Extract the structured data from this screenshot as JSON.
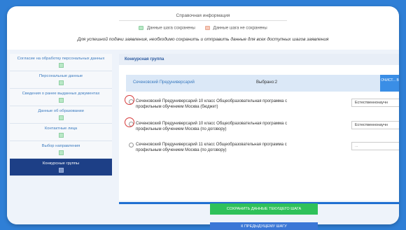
{
  "header": {
    "title": "Справочная информация",
    "legend_saved": "Данные шага сохранены",
    "legend_unsaved": "Данные шага не сохранены",
    "note": "Для успешной подачи заявления, необходимо сохранить и отправить данные для всех доступных шагов заявления",
    "colors": {
      "saved": "#b9e8c6",
      "unsaved": "#f6c9b8"
    }
  },
  "sidebar": {
    "items": [
      {
        "label": "Согласие на обработку персональных данных",
        "active": false
      },
      {
        "label": "Персональные данные",
        "active": false
      },
      {
        "label": "Сведения о ранее выданных документах",
        "active": false
      },
      {
        "label": "Данные об образовании",
        "active": false
      },
      {
        "label": "Контактные лица",
        "active": false
      },
      {
        "label": "Выбор направления",
        "active": false
      },
      {
        "label": "Конкурсные группы",
        "active": true
      }
    ]
  },
  "content": {
    "section_title": "Конкурсная группа",
    "university": "Сеченовский Предуниверсарий",
    "selected": "Выбрано:2",
    "clear_button": "ОЧИСТ... ВЫБ...",
    "programs": [
      {
        "text": "Сеченовский Предуниверсарий 10 класс Общеобразовательная программа с профильным обучением Москва (бюджет)",
        "select": "Естественнонаучн",
        "highlighted": true
      },
      {
        "text": "Сеченовский Предуниверсарий 10 класс Общеобразовательная программа с профильным обучением Москва (по договору)",
        "select": "Естественнонаучн",
        "highlighted": true
      },
      {
        "text": "Сеченовский Предуниверсарий 11 класс Общеобразовательная программа с профильным обучением Москва (по договору)",
        "select": "...",
        "highlighted": false
      }
    ]
  },
  "buttons": {
    "save": "СОХРАНИТЬ ДАННЫЕ ТЕКУЩЕГО ШАГА",
    "prev": "К ПРЕДЫДУЩЕМУ ШАГУ"
  }
}
